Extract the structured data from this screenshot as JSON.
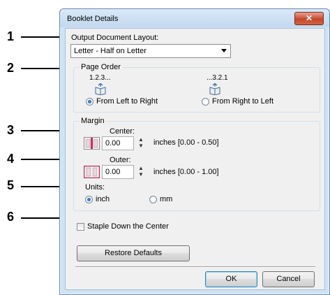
{
  "callouts": [
    "1",
    "2",
    "3",
    "4",
    "5",
    "6"
  ],
  "window": {
    "title": "Booklet Details",
    "close_label": "✕"
  },
  "output_layout": {
    "label": "Output Document Layout:",
    "selected": "Letter - Half on Letter"
  },
  "page_order": {
    "group_title": "Page Order",
    "ltr_sequence": "1.2.3...",
    "rtl_sequence": "...3.2.1",
    "ltr_label": "From Left to Right",
    "rtl_label": "From Right to Left",
    "selected": "ltr"
  },
  "margin": {
    "group_title": "Margin",
    "center_label": "Center:",
    "center_value": "0.00",
    "center_range": "inches [0.00 - 0.50]",
    "outer_label": "Outer:",
    "outer_value": "0.00",
    "outer_range": "inches [0.00 - 1.00]"
  },
  "units": {
    "label": "Units:",
    "inch_label": "inch",
    "mm_label": "mm",
    "selected": "inch"
  },
  "staple": {
    "label": "Staple Down the Center",
    "checked": false
  },
  "buttons": {
    "restore_defaults": "Restore Defaults",
    "ok": "OK",
    "cancel": "Cancel"
  },
  "colors": {
    "accent": "#1d4f9c",
    "center_icon": "#c03060",
    "outer_icon": "#c03060"
  }
}
